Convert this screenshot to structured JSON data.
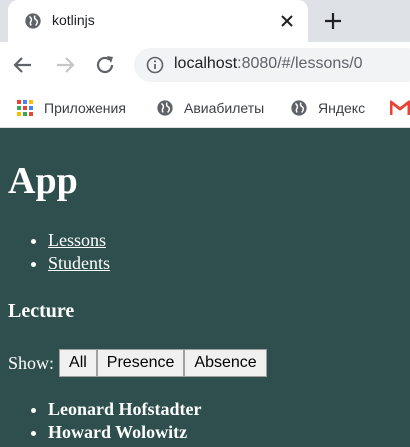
{
  "browser": {
    "tab_title": "kotlinjs",
    "url_host": "localhost",
    "url_rest": ":8080/#/lessons/0",
    "bookmarks": [
      {
        "label": "Приложения",
        "icon": "apps-grid-icon"
      },
      {
        "label": "Авиабилеты",
        "icon": "globe-icon"
      },
      {
        "label": "Яндекс",
        "icon": "globe-icon"
      }
    ]
  },
  "app": {
    "title": "App",
    "nav": [
      "Lessons",
      "Students"
    ],
    "section_title": "Lecture",
    "filter_label": "Show:",
    "filters": [
      "All",
      "Presence",
      "Absence"
    ],
    "students": [
      "Leonard Hofstadter",
      "Howard Wolowitz"
    ]
  },
  "colors": {
    "page_background": "#2f4f4f",
    "tab_strip": "#dee1e6"
  }
}
